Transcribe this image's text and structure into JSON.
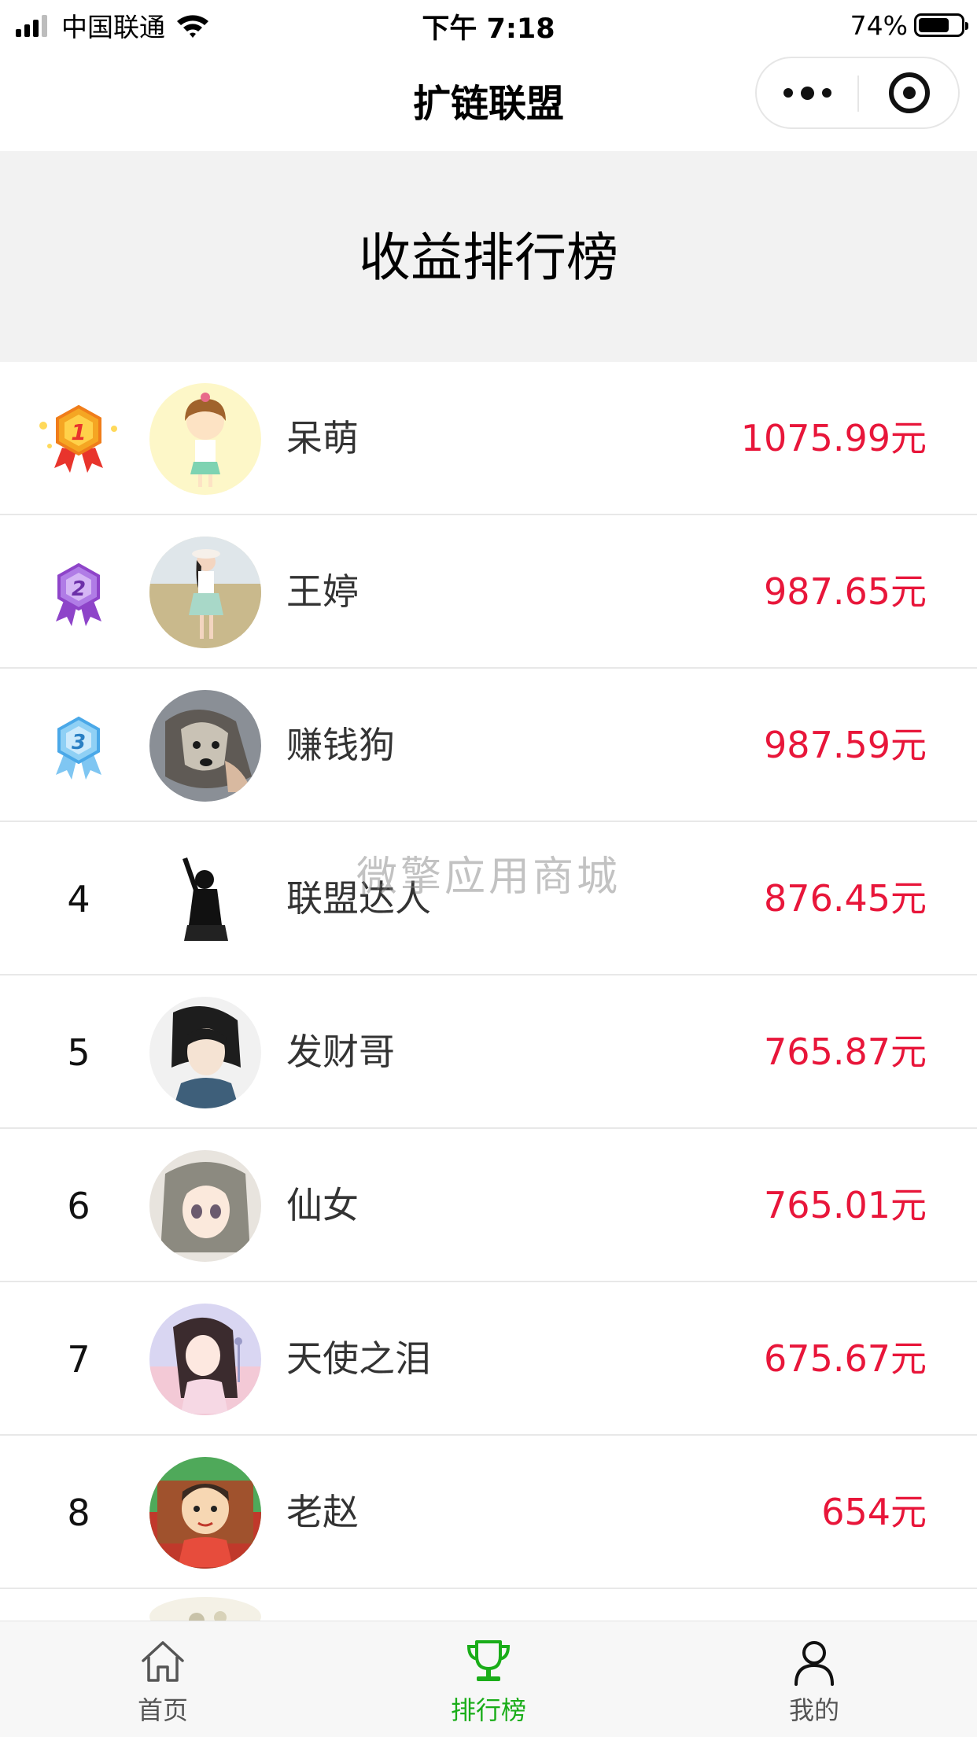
{
  "status_bar": {
    "carrier": "中国联通",
    "time": "下午 7:18",
    "battery_percent": "74%",
    "battery_level": 0.74,
    "signal_bars_active": 3,
    "signal_bars_total": 4
  },
  "nav": {
    "title": "扩链联盟",
    "more_icon": "more-dots-icon",
    "close_icon": "target-circle-icon"
  },
  "banner": {
    "title": "收益排行榜"
  },
  "leaderboard": [
    {
      "rank": "1",
      "medal": "gold",
      "name": "呆萌",
      "earnings": "1075.99元"
    },
    {
      "rank": "2",
      "medal": "purple",
      "name": "王婷",
      "earnings": "987.65元"
    },
    {
      "rank": "3",
      "medal": "blue",
      "name": "赚钱狗",
      "earnings": "987.59元"
    },
    {
      "rank": "4",
      "medal": "",
      "name": "联盟达人",
      "earnings": "876.45元"
    },
    {
      "rank": "5",
      "medal": "",
      "name": "发财哥",
      "earnings": "765.87元"
    },
    {
      "rank": "6",
      "medal": "",
      "name": "仙女",
      "earnings": "765.01元"
    },
    {
      "rank": "7",
      "medal": "",
      "name": "天使之泪",
      "earnings": "675.67元"
    },
    {
      "rank": "8",
      "medal": "",
      "name": "老赵",
      "earnings": "654元"
    }
  ],
  "watermark": "微擎应用商城",
  "tab_bar": {
    "tabs": [
      {
        "label": "首页",
        "icon": "home-icon",
        "active": false
      },
      {
        "label": "排行榜",
        "icon": "trophy-icon",
        "active": true
      },
      {
        "label": "我的",
        "icon": "user-icon",
        "active": false
      }
    ]
  },
  "colors": {
    "earnings": "#e8163a",
    "active_tab": "#1aad19",
    "banner_bg": "#f2f2f2",
    "gold_medal": "#f5a623",
    "purple_medal": "#9b59d6",
    "blue_medal": "#4aa8e8"
  }
}
